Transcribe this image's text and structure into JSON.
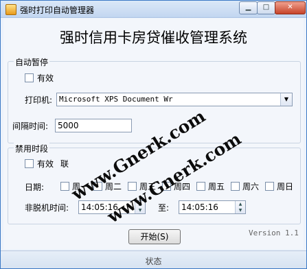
{
  "window": {
    "title": "强时打印自动管理器",
    "controls": {
      "minimize": "▁",
      "maximize": "□",
      "close": "✕"
    }
  },
  "header": {
    "title": "强时信用卡房贷催收管理系统"
  },
  "auto_pause": {
    "group_label": "自动暂停",
    "enabled_label": "有效",
    "printer_label": "打印机:",
    "printer_value": "Microsoft XPS Document Wr",
    "interval_label": "间隔时间:",
    "interval_value": "5000"
  },
  "disable_period": {
    "group_label": "禁用时段",
    "enabled_label": "有效",
    "offline_label": "联",
    "date_label": "日期:",
    "days": [
      "周一",
      "周二",
      "周三",
      "周四",
      "周五",
      "周六",
      "周日"
    ],
    "time_label": "非脱机时间:",
    "from_time": "14:05:16",
    "to_label": "至:",
    "to_time": "14:05:16"
  },
  "actions": {
    "start_label": "开始(S)"
  },
  "version": "Version 1.1",
  "status": {
    "text": "状态"
  },
  "watermarks": [
    "www.Gnerk.com",
    "www.Gnerk.com"
  ]
}
